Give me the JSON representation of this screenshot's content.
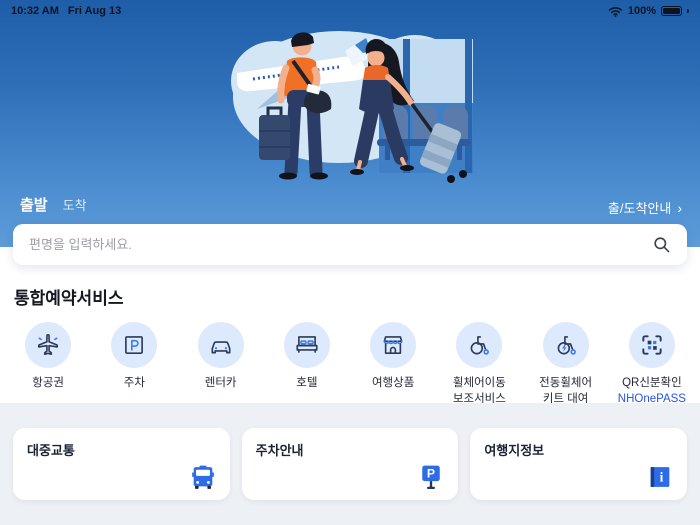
{
  "status_bar": {
    "time": "10:32 AM",
    "date": "Fri Aug 13",
    "battery_percent": "100%"
  },
  "header": {
    "tab_departure": "출발",
    "tab_arrival": "도착",
    "arrivals_link": "출/도착안내",
    "arrivals_chevron": "›"
  },
  "search": {
    "placeholder": "편명을 입력하세요."
  },
  "services": {
    "title": "통합예약서비스",
    "items": [
      {
        "label": "항공권",
        "icon": "flight-icon"
      },
      {
        "label": "주차",
        "icon": "parking-icon"
      },
      {
        "label": "렌터카",
        "icon": "rentcar-icon"
      },
      {
        "label": "호텔",
        "icon": "hotel-icon"
      },
      {
        "label": "여행상품",
        "icon": "travel-products-icon"
      },
      {
        "label": "휠체어이동\n보조서비스",
        "icon": "wheelchair-icon"
      },
      {
        "label": "전동휠체어\n키트 대여",
        "icon": "electric-wheelchair-icon"
      },
      {
        "label": "QR신분확인",
        "brand": "NHOnePASS",
        "icon": "qr-icon"
      }
    ]
  },
  "cards": [
    {
      "label": "대중교통",
      "icon": "bus-icon"
    },
    {
      "label": "주차안내",
      "icon": "parking-sign-icon"
    },
    {
      "label": "여행지정보",
      "icon": "info-icon"
    }
  ],
  "colors": {
    "header_top": "#1e5ea8",
    "header_bottom": "#5d9cd9",
    "accent_blue": "#2e6be6",
    "brand_blue": "#2456e8",
    "icon_stroke": "#2c3a57",
    "icon_accent": "#3b7df0",
    "circle_bg": "#ddeafd",
    "section_bg": "#edf0f4"
  }
}
